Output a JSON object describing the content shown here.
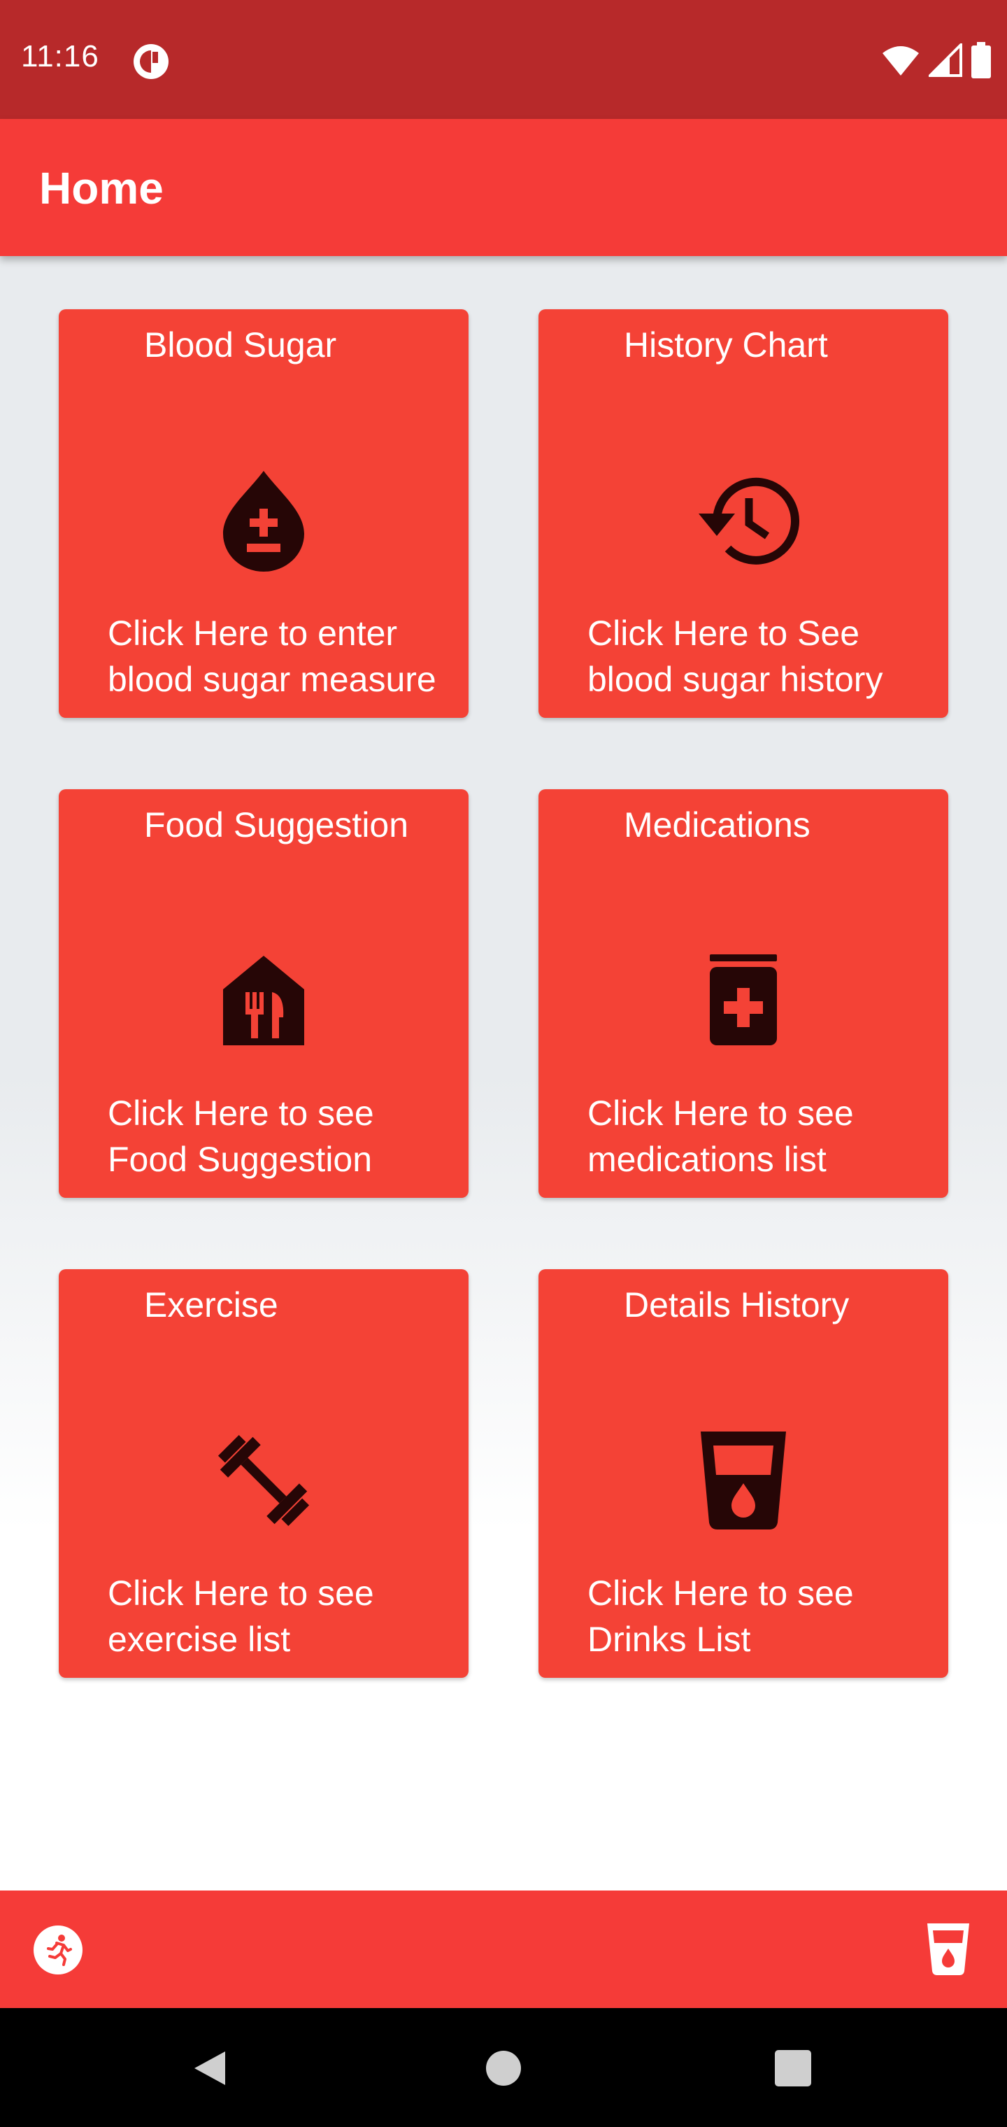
{
  "status_bar": {
    "time": "11:16",
    "icons": [
      "app-notification-icon",
      "wifi-icon",
      "signal-icon",
      "battery-icon"
    ]
  },
  "app_bar": {
    "title": "Home"
  },
  "cards": [
    {
      "title": "Blood Sugar",
      "icon": "blood-drop-plus-minus-icon",
      "desc_line1": "Click Here to enter",
      "desc_line2": "blood sugar measure"
    },
    {
      "title": "History Chart",
      "icon": "history-clock-icon",
      "desc_line1": "Click Here to See",
      "desc_line2": "blood sugar history"
    },
    {
      "title": "Food Suggestion",
      "icon": "restaurant-house-icon",
      "desc_line1": "Click Here to see",
      "desc_line2": "Food Suggestion"
    },
    {
      "title": "Medications",
      "icon": "medication-jar-icon",
      "desc_line1": "Click Here to see",
      "desc_line2": "medications list"
    },
    {
      "title": "Exercise",
      "icon": "dumbbell-icon",
      "desc_line1": "Click Here to see",
      "desc_line2": "exercise list"
    },
    {
      "title": "Details History",
      "icon": "drink-cup-icon",
      "desc_line1": "Click Here to see",
      "desc_line2": "Drinks List"
    }
  ],
  "bottom_bar": {
    "left_icon": "running-person-icon",
    "right_icon": "drink-cup-icon"
  },
  "colors": {
    "status_bar": "#b7292a",
    "app_bar": "#f53b38",
    "card": "#f44236",
    "icon": "#260606"
  }
}
